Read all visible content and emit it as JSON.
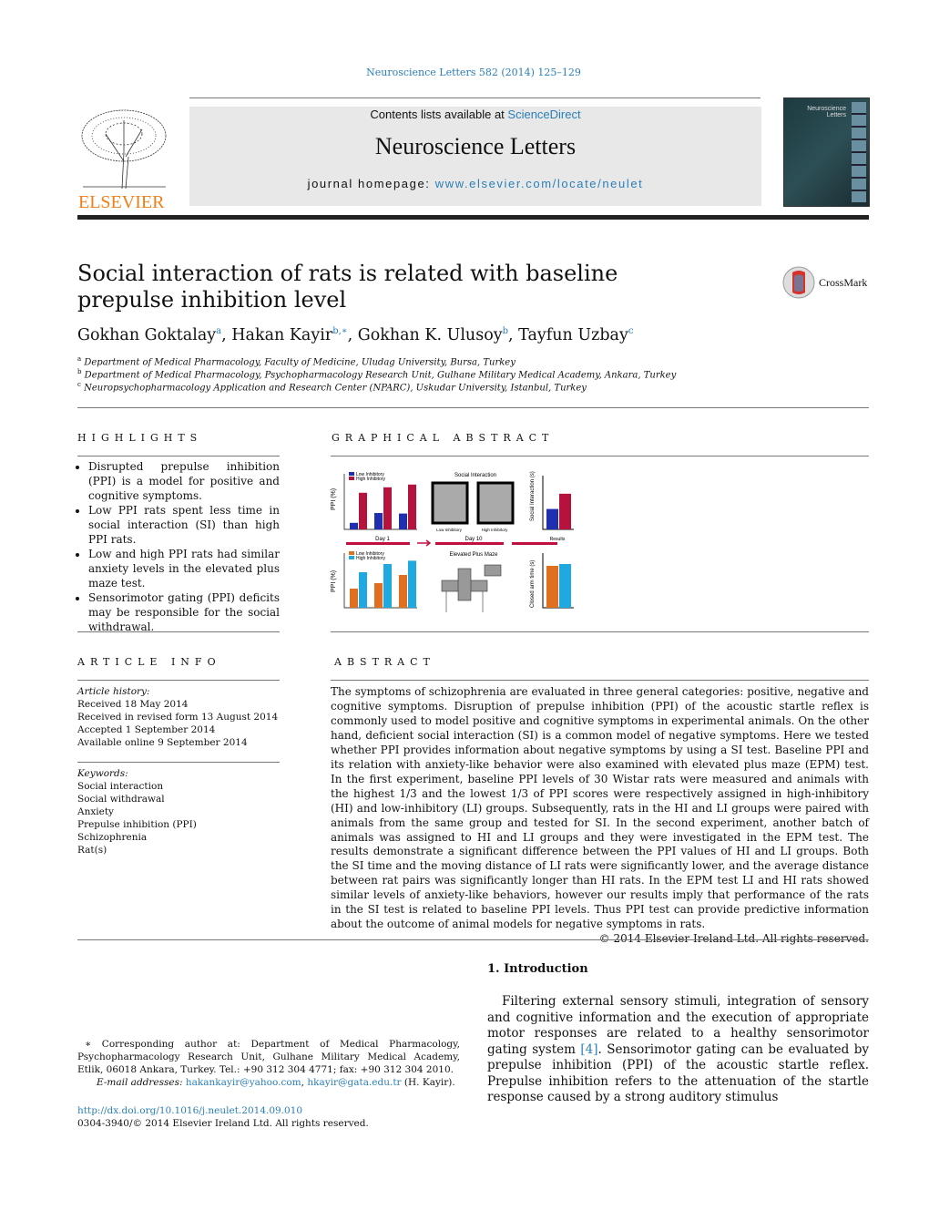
{
  "citation": "Neuroscience Letters 582 (2014) 125–129",
  "header": {
    "contents_prefix": "Contents lists available at ",
    "contents_link": "ScienceDirect",
    "journal": "Neuroscience Letters",
    "homepage_prefix": "journal homepage: ",
    "homepage_link": "www.elsevier.com/locate/neulet",
    "publisher": "ELSEVIER",
    "cover_text": "Neuroscience Letters"
  },
  "article": {
    "title": "Social interaction of rats is related with baseline prepulse inhibition level",
    "crossmark": "CrossMark",
    "authors": [
      {
        "name": "Gokhan Goktalay",
        "sup": "a"
      },
      {
        "name": "Hakan Kayir",
        "sup": "b,∗"
      },
      {
        "name": "Gokhan K. Ulusoy",
        "sup": "b"
      },
      {
        "name": "Tayfun Uzbay",
        "sup": "c"
      }
    ],
    "affiliations": [
      {
        "sup": "a",
        "text": "Department of Medical Pharmacology, Faculty of Medicine, Uludag University, Bursa, Turkey"
      },
      {
        "sup": "b",
        "text": "Department of Medical Pharmacology, Psychopharmacology Research Unit, Gulhane Military Medical Academy, Ankara, Turkey"
      },
      {
        "sup": "c",
        "text": "Neuropsychopharmacology Application and Research Center (NPARC), Uskudar University, Istanbul, Turkey"
      }
    ]
  },
  "highlights": {
    "heading": "HIGHLIGHTS",
    "items": [
      "Disrupted prepulse inhibition (PPI) is a model for positive and cognitive symptoms.",
      "Low PPI rats spent less time in social interaction (SI) than high PPI rats.",
      "Low and high PPI rats had similar anxiety levels in the elevated plus maze test.",
      "Sensorimotor gating (PPI) deficits may be responsible for the social withdrawal."
    ]
  },
  "graphical_abstract": {
    "heading": "GRAPHICAL ABSTRACT",
    "legend_low": "Low Inhibitory",
    "legend_high": "High Inhibitory",
    "ppi_label": "PPI (%)",
    "si_title": "Social Interaction",
    "si_low": "Low Inhibitory",
    "si_high": "High Inhibitory",
    "si_axis": "Social Interaction (s)",
    "epm_title": "Elevated Plus Maze",
    "epm_axis": "Closed arm time (s)",
    "day1": "Day 1",
    "day10": "Day 10",
    "results": "Results",
    "colors": {
      "low_top": "#1f2fb0",
      "high_top": "#b5123d",
      "low_bottom": "#e07020",
      "high_bottom": "#20a8e0"
    },
    "ppi_top": {
      "low": [
        12,
        30,
        29
      ],
      "high": [
        67,
        77,
        82
      ]
    },
    "ppi_bottom": {
      "low": [
        35,
        45,
        60
      ],
      "high": [
        65,
        80,
        86
      ]
    },
    "si": {
      "low": 83,
      "high": 145
    },
    "epm": {
      "low": 230,
      "high": 240
    }
  },
  "article_info": {
    "heading": "ARTICLE INFO",
    "history_label": "Article history:",
    "history": [
      "Received 18 May 2014",
      "Received in revised form 13 August 2014",
      "Accepted 1 September 2014",
      "Available online 9 September 2014"
    ],
    "keywords_label": "Keywords:",
    "keywords": [
      "Social interaction",
      "Social withdrawal",
      "Anxiety",
      "Prepulse inhibition (PPI)",
      "Schizophrenia",
      "Rat(s)"
    ]
  },
  "abstract": {
    "heading": "ABSTRACT",
    "text": "The symptoms of schizophrenia are evaluated in three general categories: positive, negative and cognitive symptoms. Disruption of prepulse inhibition (PPI) of the acoustic startle reflex is commonly used to model positive and cognitive symptoms in experimental animals. On the other hand, deficient social interaction (SI) is a common model of negative symptoms. Here we tested whether PPI provides information about negative symptoms by using a SI test. Baseline PPI and its relation with anxiety-like behavior were also examined with elevated plus maze (EPM) test. In the first experiment, baseline PPI levels of 30 Wistar rats were measured and animals with the highest 1/3 and the lowest 1/3 of PPI scores were respectively assigned in high-inhibitory (HI) and low-inhibitory (LI) groups. Subsequently, rats in the HI and LI groups were paired with animals from the same group and tested for SI. In the second experiment, another batch of animals was assigned to HI and LI groups and they were investigated in the EPM test. The results demonstrate a significant difference between the PPI values of HI and LI groups. Both the SI time and the moving distance of LI rats were significantly lower, and the average distance between rat pairs was significantly longer than HI rats. In the EPM test LI and HI rats showed similar levels of anxiety-like behaviors, however our results imply that performance of the rats in the SI test is related to baseline PPI levels. Thus PPI test can provide predictive information about the outcome of animal models for negative symptoms in rats.",
    "copyright": "© 2014 Elsevier Ireland Ltd. All rights reserved."
  },
  "introduction": {
    "heading": "1.  Introduction",
    "text_before": "Filtering external sensory stimuli, integration of sensory and cognitive information and the execution of appropriate motor responses are related to a healthy sensorimotor gating system ",
    "ref": "[4]",
    "text_after": ". Sensorimotor gating can be evaluated by prepulse inhibition (PPI) of the acoustic startle reflex. Prepulse inhibition refers to the attenuation of the startle response caused by a strong auditory stimulus"
  },
  "footnote": {
    "text": "∗  Corresponding author at: Department of Medical Pharmacology, Psychopharmacology Research Unit, Gulhane Military Medical Academy, Etlik, 06018 Ankara, Turkey. Tel.: +90 312 304 4771; fax: +90 312 304 2010.",
    "email_label": "E-mail addresses: ",
    "email1": "hakankayir@yahoo.com",
    "email_sep": ", ",
    "email2": "hkayir@gata.edu.tr",
    "email_suffix": " (H. Kayir)."
  },
  "doi": "http://dx.doi.org/10.1016/j.neulet.2014.09.010",
  "issn": "0304-3940/© 2014 Elsevier Ireland Ltd. All rights reserved."
}
